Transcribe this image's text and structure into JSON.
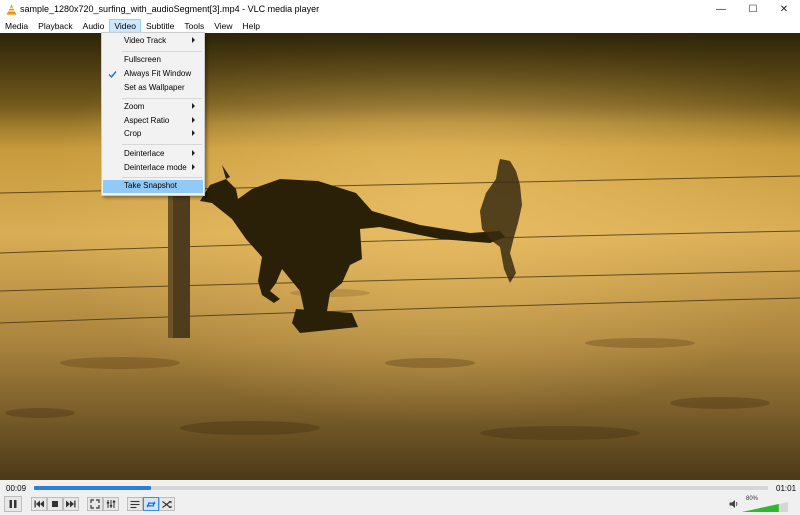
{
  "window": {
    "title": "sample_1280x720_surfing_with_audioSegment[3].mp4 - VLC media player",
    "min_glyph": "—",
    "max_glyph": "☐",
    "close_glyph": "✕",
    "app_icon": "vlc-cone-icon"
  },
  "menubar": {
    "items": [
      "Media",
      "Playback",
      "Audio",
      "Video",
      "Subtitle",
      "Tools",
      "View",
      "Help"
    ],
    "active": "Video"
  },
  "video_menu": {
    "items": [
      {
        "label": "Video Track",
        "submenu": true
      },
      {
        "label": "Fullscreen",
        "submenu": false
      },
      {
        "label": "Always Fit Window",
        "submenu": false,
        "checked": true
      },
      {
        "label": "Set as Wallpaper",
        "submenu": false
      },
      {
        "label": "Zoom",
        "submenu": true
      },
      {
        "label": "Aspect Ratio",
        "submenu": true
      },
      {
        "label": "Crop",
        "submenu": true
      },
      {
        "label": "Deinterlace",
        "submenu": true
      },
      {
        "label": "Deinterlace mode",
        "submenu": true
      },
      {
        "label": "Take Snapshot",
        "submenu": false,
        "highlighted": true
      }
    ]
  },
  "playback": {
    "elapsed": "00:09",
    "total": "01:01",
    "progress": 0.16,
    "volume_label": "80%",
    "volume": 0.8
  },
  "controls": {
    "icons": [
      "pause-icon",
      "previous-icon",
      "stop-icon",
      "next-icon",
      "fullscreen-icon",
      "extended-settings-icon",
      "playlist-icon",
      "loop-icon",
      "shuffle-icon",
      "speaker-icon"
    ]
  },
  "colors": {
    "accent": "#2b7fd6",
    "menu_highlight": "#91c9f7",
    "volume_green": "#2fb82f"
  }
}
